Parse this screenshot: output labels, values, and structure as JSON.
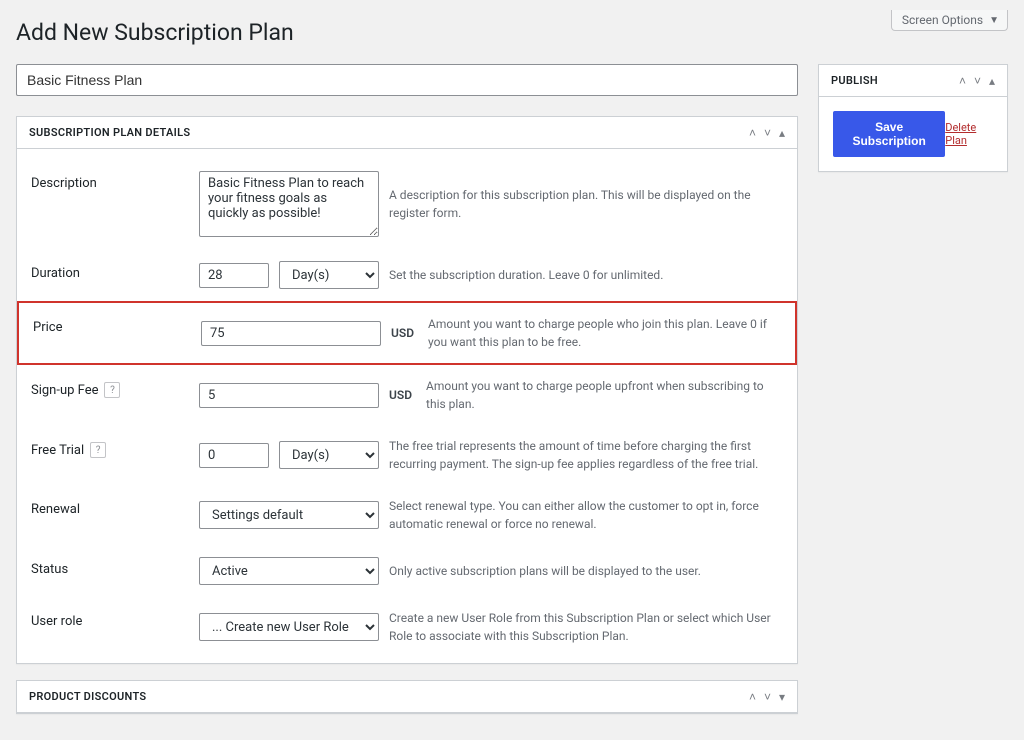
{
  "screen_options_label": "Screen Options",
  "page_title": "Add New Subscription Plan",
  "title_value": "Basic Fitness Plan",
  "publish": {
    "heading": "PUBLISH",
    "save_label": "Save Subscription",
    "delete_label": "Delete Plan"
  },
  "details": {
    "heading": "SUBSCRIPTION PLAN DETAILS",
    "fields": {
      "description": {
        "label": "Description",
        "value": "Basic Fitness Plan to reach your fitness goals as quickly as possible!",
        "help": "A description for this subscription plan. This will be displayed on the register form."
      },
      "duration": {
        "label": "Duration",
        "value": "28",
        "unit_selected": "Day(s)",
        "help": "Set the subscription duration. Leave 0 for unlimited."
      },
      "price": {
        "label": "Price",
        "value": "75",
        "currency": "USD",
        "help": "Amount you want to charge people who join this plan. Leave 0 if you want this plan to be free."
      },
      "signup_fee": {
        "label": "Sign-up Fee",
        "value": "5",
        "currency": "USD",
        "help": "Amount you want to charge people upfront when subscribing to this plan."
      },
      "free_trial": {
        "label": "Free Trial",
        "value": "0",
        "unit_selected": "Day(s)",
        "help": "The free trial represents the amount of time before charging the first recurring payment. The sign-up fee applies regardless of the free trial."
      },
      "renewal": {
        "label": "Renewal",
        "selected": "Settings default",
        "help": "Select renewal type. You can either allow the customer to opt in, force automatic renewal or force no renewal."
      },
      "status": {
        "label": "Status",
        "selected": "Active",
        "help": "Only active subscription plans will be displayed to the user."
      },
      "user_role": {
        "label": "User role",
        "selected": "... Create new User Role",
        "help": "Create a new User Role from this Subscription Plan or select which User Role to associate with this Subscription Plan."
      }
    }
  },
  "discounts": {
    "heading": "PRODUCT DISCOUNTS"
  }
}
